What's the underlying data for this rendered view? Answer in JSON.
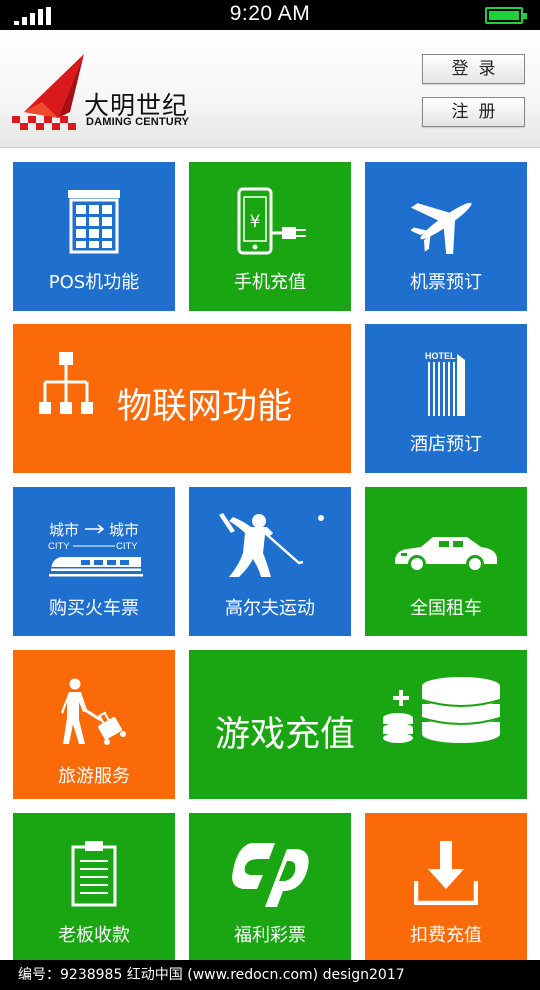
{
  "status_bar": {
    "time": "9:20 AM"
  },
  "header": {
    "brand_cn": "大明世纪",
    "brand_en": "DAMING CENTURY",
    "login_label": "登录",
    "register_label": "注册"
  },
  "tiles": {
    "pos": "POS机功能",
    "phone_recharge": "手机充值",
    "flight": "机票预订",
    "iot": "物联网功能",
    "hotel": "酒店预订",
    "hotel_sign": "HOTEL",
    "train": "购买火车票",
    "train_from": "城市",
    "train_to": "城市",
    "train_from_en": "CITY",
    "train_to_en": "CITY",
    "golf": "高尔夫运动",
    "car": "全国租车",
    "travel": "旅游服务",
    "game": "游戏充值",
    "boss": "老板收款",
    "lottery": "福利彩票",
    "deduct": "扣费充值"
  },
  "footer": {
    "text": "编号：9238985    红动中国 (www.redocn.com)    design2017"
  },
  "colors": {
    "blue": "#1e6fce",
    "green": "#1aa512",
    "orange": "#fb6a09"
  }
}
